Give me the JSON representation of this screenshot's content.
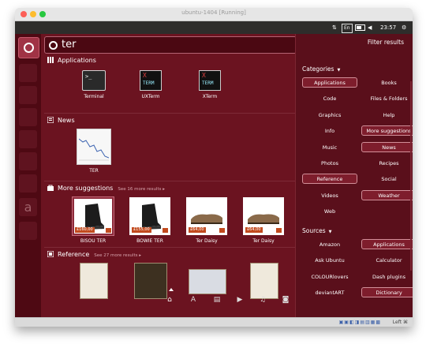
{
  "window": {
    "title": "ubuntu-1404 [Running]"
  },
  "topbar": {
    "keyboard": "En",
    "time": "23:57"
  },
  "search": {
    "query": "ter"
  },
  "sections": {
    "applications": {
      "title": "Applications",
      "items": [
        {
          "label": "Terminal"
        },
        {
          "label": "UXTerm"
        },
        {
          "label": "XTerm"
        }
      ]
    },
    "news": {
      "title": "News",
      "items": [
        {
          "label": "TER"
        }
      ]
    },
    "suggestions": {
      "title": "More suggestions",
      "more": "See 16 more results ▸",
      "items": [
        {
          "label": "BISOU TER",
          "price": "£160,00"
        },
        {
          "label": "BOWIE TER",
          "price": "£155,00"
        },
        {
          "label": "Ter Daisy",
          "price": "£64,00"
        },
        {
          "label": "Ter Daisy",
          "price": "£64,00"
        }
      ]
    },
    "reference": {
      "title": "Reference",
      "more": "See 27 more results ▸"
    }
  },
  "filters": {
    "title": "Filter results",
    "categories_title": "Categories",
    "categories": [
      {
        "label": "Applications",
        "on": true
      },
      {
        "label": "Books",
        "on": false
      },
      {
        "label": "Code",
        "on": false
      },
      {
        "label": "Files & Folders",
        "on": false
      },
      {
        "label": "Graphics",
        "on": false
      },
      {
        "label": "Help",
        "on": false
      },
      {
        "label": "Info",
        "on": false
      },
      {
        "label": "More suggestions",
        "on": true
      },
      {
        "label": "Music",
        "on": false
      },
      {
        "label": "News",
        "on": true
      },
      {
        "label": "Photos",
        "on": false
      },
      {
        "label": "Recipes",
        "on": false
      },
      {
        "label": "Reference",
        "on": true
      },
      {
        "label": "Social",
        "on": false
      },
      {
        "label": "Videos",
        "on": false
      },
      {
        "label": "Weather",
        "on": true
      },
      {
        "label": "Web",
        "on": false
      }
    ],
    "sources_title": "Sources",
    "sources": [
      {
        "label": "Amazon",
        "on": false
      },
      {
        "label": "Applications",
        "on": true
      },
      {
        "label": "Ask Ubuntu",
        "on": false
      },
      {
        "label": "Calculator",
        "on": false
      },
      {
        "label": "COLOURlovers",
        "on": false
      },
      {
        "label": "Dash plugins",
        "on": false
      },
      {
        "label": "deviantART",
        "on": false
      },
      {
        "label": "Dictionary",
        "on": true
      }
    ]
  },
  "statusbar": {
    "hostkey": "Left ⌘"
  },
  "colors": {
    "panel": "#6b1320",
    "accent": "#d28f99"
  }
}
